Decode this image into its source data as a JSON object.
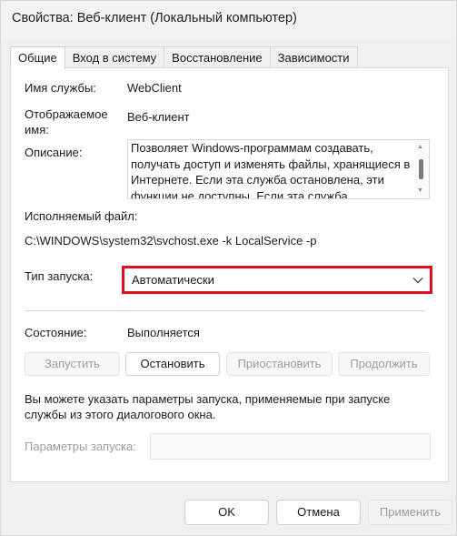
{
  "window": {
    "title": "Свойства: Веб-клиент (Локальный компьютер)"
  },
  "tabs": [
    {
      "label": "Общие",
      "active": true
    },
    {
      "label": "Вход в систему",
      "active": false
    },
    {
      "label": "Восстановление",
      "active": false
    },
    {
      "label": "Зависимости",
      "active": false
    }
  ],
  "general": {
    "service_name_label": "Имя службы:",
    "service_name_value": "WebClient",
    "display_name_label_line1": "Отображаемое",
    "display_name_label_line2": "имя:",
    "display_name_value": "Веб-клиент",
    "description_label": "Описание:",
    "description_value": "Позволяет Windows-программам создавать, получать доступ и изменять файлы, хранящиеся в Интернете. Если эта служба остановлена, эти функции не доступны. Если эта служба",
    "executable_label": "Исполняемый файл:",
    "executable_value": "C:\\WINDOWS\\system32\\svchost.exe -k LocalService -p",
    "startup_type_label": "Тип запуска:",
    "startup_type_value": "Автоматически",
    "status_label": "Состояние:",
    "status_value": "Выполняется",
    "buttons": {
      "start": "Запустить",
      "stop": "Остановить",
      "pause": "Приостановить",
      "resume": "Продолжить"
    },
    "hint_line1": "Вы можете указать параметры запуска, применяемые при запуске",
    "hint_line2": "службы из этого диалогового окна.",
    "start_params_label": "Параметры запуска:",
    "start_params_value": ""
  },
  "footer": {
    "ok": "OK",
    "cancel": "Отмена",
    "apply": "Применить"
  },
  "colors": {
    "highlight_border": "#e01022"
  }
}
